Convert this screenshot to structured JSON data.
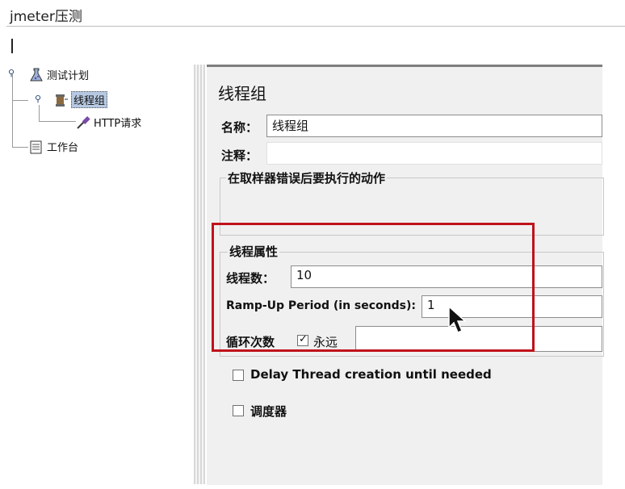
{
  "window": {
    "title": "jmeter压测"
  },
  "tree": {
    "items": [
      {
        "label": "测试计划",
        "icon": "flask-icon"
      },
      {
        "label": "线程组",
        "icon": "spool-icon",
        "selected": true
      },
      {
        "label": "HTTP请求",
        "icon": "pipette-icon"
      },
      {
        "label": "工作台",
        "icon": "clipboard-icon"
      }
    ]
  },
  "panel": {
    "title": "线程组",
    "name_label": "名称：",
    "name_value": "线程组",
    "comment_label": "注释：",
    "comment_value": "",
    "error_action_label": "在取样器错误后要执行的动作",
    "thread_props": {
      "label": "线程属性",
      "threads_label": "线程数：",
      "threads_value": "10",
      "rampup_label": "Ramp-Up Period (in seconds):",
      "rampup_value": "1",
      "loop_label": "循环次数",
      "forever_label": "永远",
      "forever_checked": true,
      "loop_value": ""
    },
    "delay_label": "Delay Thread creation until needed",
    "delay_checked": false,
    "scheduler_label": "调度器",
    "scheduler_checked": false
  },
  "colors": {
    "highlight": "#c0121c",
    "selection": "#b7c9e2"
  }
}
